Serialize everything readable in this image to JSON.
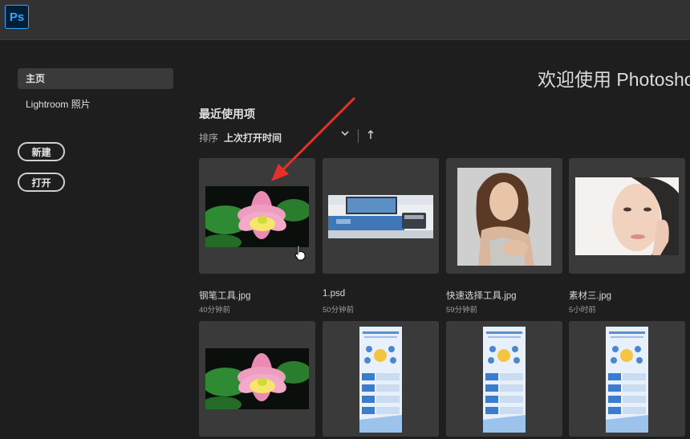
{
  "app": {
    "logo_text": "Ps",
    "accent": "#31a8ff"
  },
  "sidebar": {
    "items": [
      {
        "label": "主页",
        "active": true
      },
      {
        "label": "Lightroom 照片",
        "active": false
      }
    ],
    "buttons": {
      "new_label": "新建",
      "open_label": "打开"
    }
  },
  "main": {
    "welcome": "欢迎使用 Photoshop",
    "section_title": "最近使用项",
    "sort": {
      "label": "排序",
      "value": "上次打开时间",
      "direction_icon": "arrow-up-icon"
    },
    "recent": [
      {
        "name": "钢笔工具.jpg",
        "time": "40分钟前",
        "thumb": "lotus"
      },
      {
        "name": "1.psd",
        "time": "50分钟前",
        "thumb": "desk"
      },
      {
        "name": "快速选择工具.jpg",
        "time": "59分钟前",
        "thumb": "woman-hair"
      },
      {
        "name": "素材三.jpg",
        "time": "5小时前",
        "thumb": "woman-face"
      },
      {
        "name": "",
        "time": "",
        "thumb": "lotus"
      },
      {
        "name": "",
        "time": "",
        "thumb": "infographic"
      },
      {
        "name": "",
        "time": "",
        "thumb": "infographic"
      },
      {
        "name": "",
        "time": "",
        "thumb": "infographic"
      }
    ]
  },
  "annotation": {
    "arrow_color": "#e8302a"
  }
}
